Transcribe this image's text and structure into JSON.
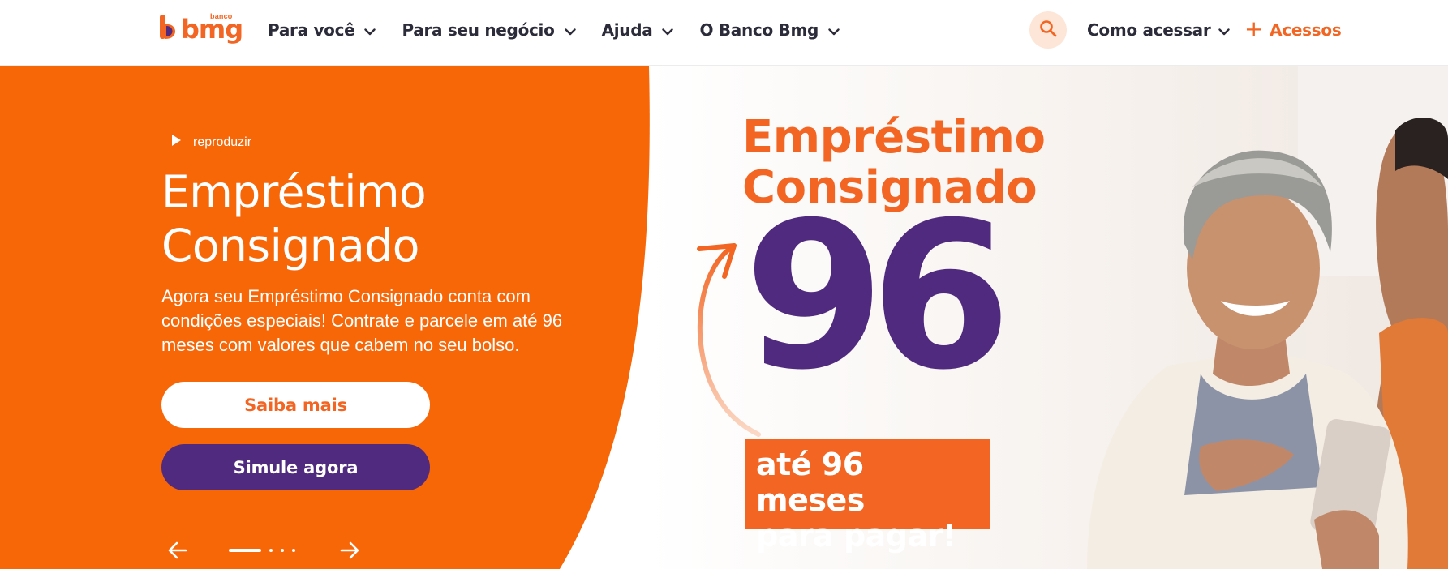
{
  "header": {
    "logo": {
      "brand": "bmg",
      "superscript": "banco"
    },
    "nav": [
      {
        "label": "Para você"
      },
      {
        "label": "Para seu negócio"
      },
      {
        "label": "Ajuda"
      },
      {
        "label": "O Banco Bmg"
      }
    ],
    "search_icon": "search-icon",
    "access": {
      "label": "Como acessar"
    },
    "acessos": {
      "label": "Acessos",
      "icon": "+"
    }
  },
  "hero": {
    "play_label": "reproduzir",
    "title_line1": "Empréstimo",
    "title_line2": "Consignado",
    "description": "Agora seu Empréstimo Consignado conta com condições especiais! Contrate e parcele em até 96 meses com valores que cabem no seu bolso.",
    "primary_button": "Saiba mais",
    "secondary_button": "Simule agora",
    "carousel": {
      "slides": 4,
      "active": 1
    }
  },
  "banner": {
    "title_line1": "Empréstimo",
    "title_line2": "Consignado",
    "number": "96",
    "tag_line1": "até 96 meses",
    "tag_line2": "para pagar!"
  },
  "colors": {
    "brand_orange": "#f26522",
    "brand_purple": "#4f2a7e",
    "text_dark": "#2b2b3a"
  }
}
